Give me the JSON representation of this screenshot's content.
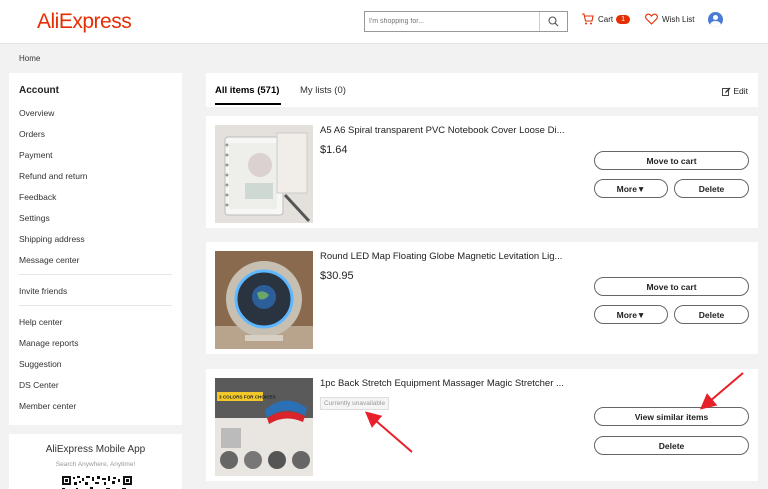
{
  "header": {
    "logo": "AliExpress",
    "search_placeholder": "I'm shopping for...",
    "cart_label": "Cart",
    "cart_count": "1",
    "wishlist_label": "Wish List"
  },
  "breadcrumb": "Home",
  "sidebar": {
    "title": "Account",
    "group1": [
      "Overview",
      "Orders",
      "Payment",
      "Refund and return",
      "Feedback",
      "Settings",
      "Shipping address",
      "Message center"
    ],
    "group2": [
      "Invite friends"
    ],
    "group3": [
      "Help center",
      "Manage reports",
      "Suggestion",
      "DS Center",
      "Member center"
    ]
  },
  "mobile": {
    "title": "AliExpress Mobile App",
    "subtitle": "Search Anywhere, Anytime!"
  },
  "tabs": {
    "all_items": "All items (571)",
    "my_lists": "My lists (0)",
    "edit": "Edit"
  },
  "items": [
    {
      "title": "A5 A6 Spiral transparent PVC Notebook Cover Loose Di...",
      "price": "$1.64",
      "move_to_cart": "Move to cart",
      "more": "More▼",
      "delete": "Delete"
    },
    {
      "title": "Round LED Map Floating Globe Magnetic Levitation Lig...",
      "price": "$30.95",
      "move_to_cart": "Move to cart",
      "more": "More▼",
      "delete": "Delete"
    },
    {
      "title": "1pc Back Stretch Equipment Massager Magic Stretcher ...",
      "status": "Currently unavailable",
      "image_caption": "3 COLORS FOR CHOICES",
      "view_similar": "View similar items",
      "delete": "Delete"
    }
  ],
  "colors": {
    "brand": "#e62e04",
    "annotation_arrow": "#e8202a"
  }
}
